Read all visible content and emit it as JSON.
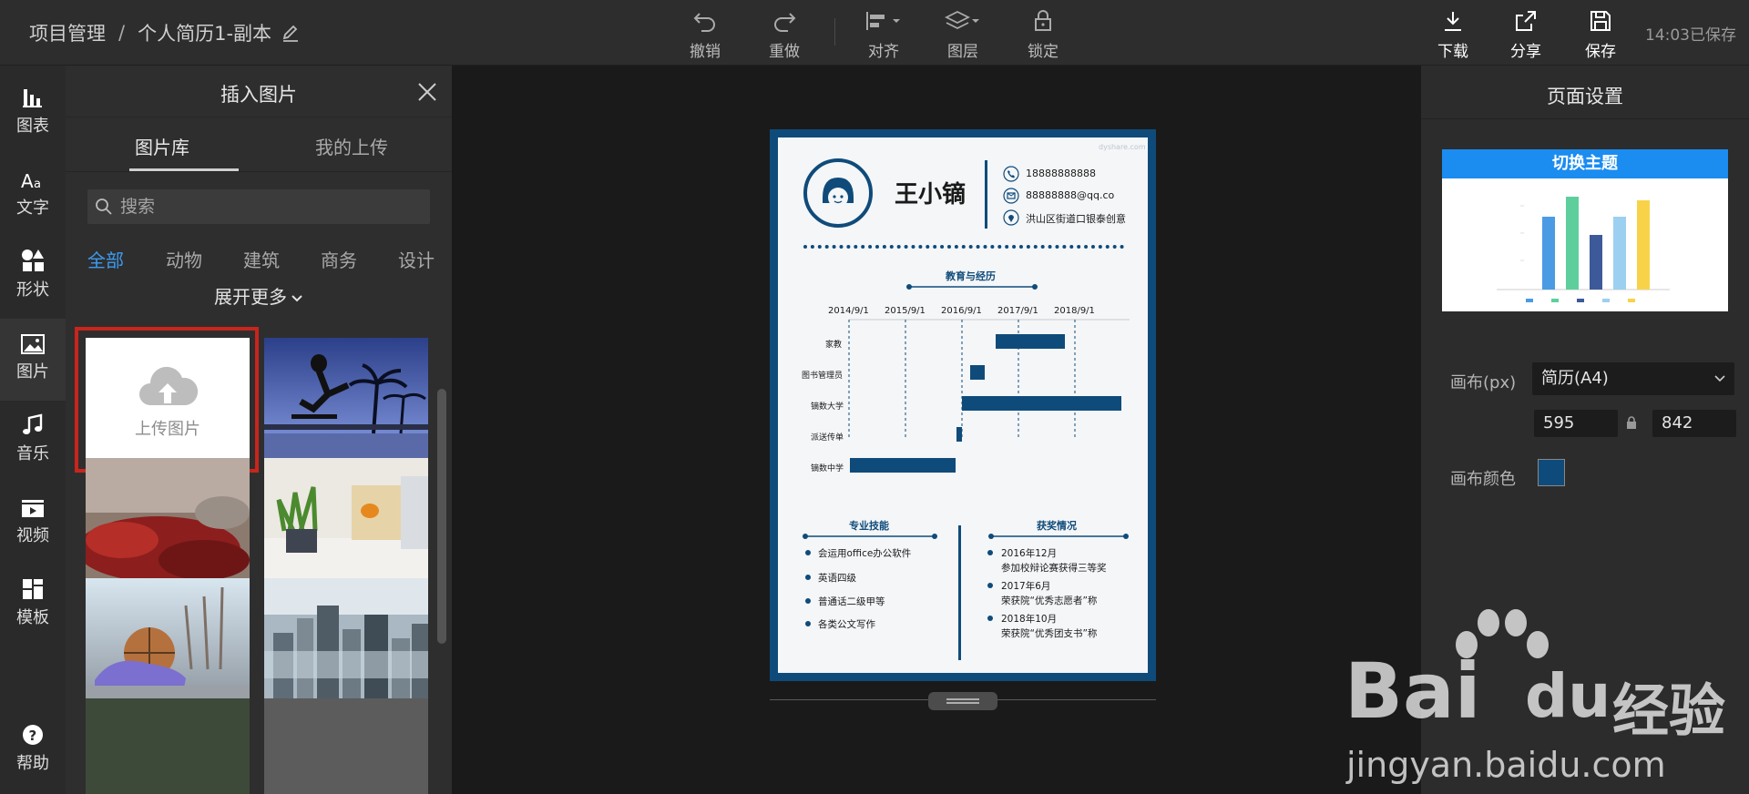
{
  "header": {
    "breadcrumb_root": "项目管理",
    "breadcrumb_sep": "/",
    "doc_title": "个人简历1-副本",
    "save_status": "14:03已保存"
  },
  "toolbar": {
    "undo": "撤销",
    "redo": "重做",
    "align": "对齐",
    "layer": "图层",
    "lock": "锁定",
    "download": "下载",
    "share": "分享",
    "save": "保存"
  },
  "rail": {
    "items": [
      {
        "label": "图表",
        "icon": "bar-chart-icon"
      },
      {
        "label": "文字",
        "icon": "text-icon"
      },
      {
        "label": "形状",
        "icon": "shapes-icon"
      },
      {
        "label": "图片",
        "icon": "image-icon"
      },
      {
        "label": "音乐",
        "icon": "music-icon"
      },
      {
        "label": "视频",
        "icon": "video-icon"
      },
      {
        "label": "模板",
        "icon": "template-icon"
      }
    ],
    "help": "帮助",
    "help_glyph": "?",
    "active_index": 3
  },
  "panel": {
    "title": "插入图片",
    "tabs": [
      "图片库",
      "我的上传"
    ],
    "active_tab": 0,
    "search_placeholder": "搜索",
    "categories": [
      "全部",
      "动物",
      "建筑",
      "商务",
      "设计"
    ],
    "active_category": 0,
    "expand_more": "展开更多",
    "upload_label": "上传图片"
  },
  "resume": {
    "name": "王小镝",
    "phone": "18888888888",
    "email": "88888888@qq.co",
    "address": "洪山区街道口银泰创意",
    "watermark": "dyshare.com",
    "section_edu": "教育与经历",
    "years": [
      "2014/9/1",
      "2015/9/1",
      "2016/9/1",
      "2017/9/1",
      "2018/9/1"
    ],
    "timeline_rows": [
      "家教",
      "图书管理员",
      "镝数大学",
      "派送传单",
      "镝数中学"
    ],
    "section_skills": "专业技能",
    "skills": [
      "会运用office办公软件",
      "英语四级",
      "普通话二级甲等",
      "各类公文写作"
    ],
    "section_awards": "获奖情况",
    "awards": [
      {
        "date": "2016年12月",
        "text": "参加校辩论赛获得三等奖"
      },
      {
        "date": "2017年6月",
        "text": "荣获院“优秀志愿者”称"
      },
      {
        "date": "2018年10月",
        "text": "荣获院“优秀团支书”称"
      }
    ],
    "colors": {
      "primary": "#0f4b7a",
      "paper": "#f4f6f8"
    }
  },
  "settings": {
    "title": "页面设置",
    "theme_label": "切换主题",
    "canvas_label": "画布(px)",
    "canvas_preset": "简历(A4)",
    "width": "595",
    "height": "842",
    "canvas_color_label": "画布颜色",
    "canvas_color": "#0f4b7a"
  },
  "watermark": {
    "brand_a": "Bai",
    "brand_b": "du",
    "brand_cn": "经验",
    "url": "jingyan.baidu.com"
  }
}
